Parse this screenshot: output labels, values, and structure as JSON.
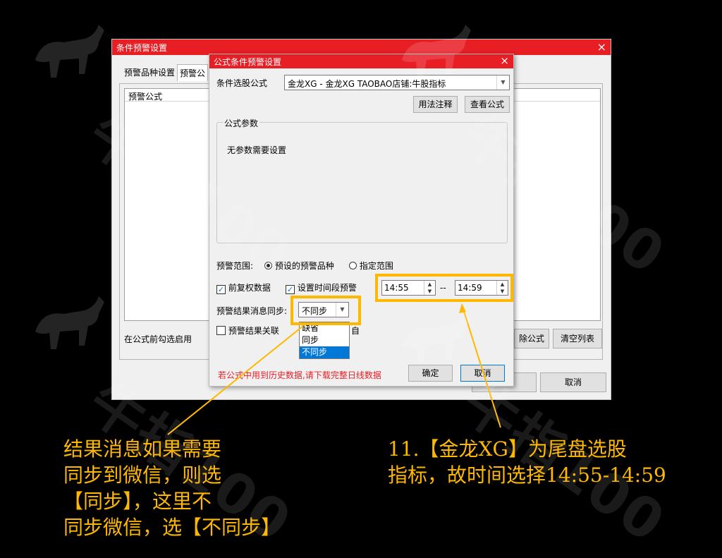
{
  "watermark": {
    "text": "牛指100"
  },
  "outer_dialog": {
    "title": "条件预警设置",
    "tabs": [
      "预警品种设置",
      "预警公"
    ],
    "list_header": "预警公式",
    "hint": "在公式前勾选启用",
    "btn_delete": "除公式",
    "btn_clear": "清空列表",
    "btn_cancel": "取消"
  },
  "inner_dialog": {
    "title": "公式条件预警设置",
    "formula_label": "条件选股公式",
    "formula_value": "金龙XG  -  金龙XG TAOBAO店铺:牛股指标",
    "btn_usage": "用法注释",
    "btn_view": "查看公式",
    "params_legend": "公式参数",
    "params_text": "无参数需要设置",
    "range_label": "预警范围:",
    "range_opt1": "预设的预警品种",
    "range_opt2": "指定范围",
    "chk_fq": "前复权数据",
    "chk_time": "设置时间段预警",
    "time_from": "14:55",
    "time_sep": "--",
    "time_to": "14:59",
    "sync_label": "预警结果消息同步:",
    "sync_value": "不同步",
    "chk_close": "预警结果关联",
    "chk_close_tail": "自",
    "sync_options": [
      "缺省",
      "同步",
      "不同步"
    ],
    "warning": "若公式中用到历史数据,请下载完整日线数据",
    "btn_ok": "确定",
    "btn_cancel": "取消"
  },
  "captions": {
    "left": [
      "结果消息如果需要",
      "同步到微信，则选",
      "【同步】，这里不",
      "同步微信，选【不同步】"
    ],
    "right": [
      "11.【金龙XG】为尾盘选股",
      "指标，故时间选择14:55-14:59"
    ]
  },
  "colors": {
    "title_bar": "#e81e25",
    "highlight": "#ffb800",
    "caption": "#ffb800"
  }
}
